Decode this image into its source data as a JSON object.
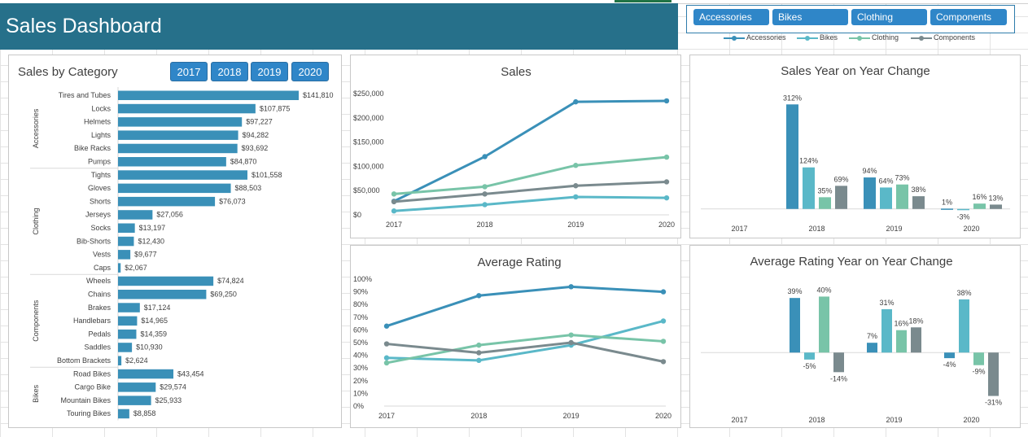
{
  "header": {
    "title": "Sales Dashboard"
  },
  "slicer": {
    "buttons": [
      "Accessories",
      "Bikes",
      "Clothing",
      "Components"
    ],
    "legend": [
      {
        "name": "Accessories",
        "color": "#3a90b8"
      },
      {
        "name": "Bikes",
        "color": "#5ab8c8"
      },
      {
        "name": "Clothing",
        "color": "#78c4a8"
      },
      {
        "name": "Components",
        "color": "#7a8a8e"
      }
    ]
  },
  "category_panel": {
    "title": "Sales by Category",
    "year_buttons": [
      "2017",
      "2018",
      "2019",
      "2020"
    ]
  },
  "chart_data": [
    {
      "id": "sales-by-category",
      "type": "bar",
      "orientation": "horizontal",
      "title": "Sales by Category",
      "color": "#3a90b8",
      "groups": [
        {
          "name": "Accessories",
          "items": [
            {
              "label": "Tires and Tubes",
              "value": 141810,
              "text": "$141,810"
            },
            {
              "label": "Locks",
              "value": 107875,
              "text": "$107,875"
            },
            {
              "label": "Helmets",
              "value": 97227,
              "text": "$97,227"
            },
            {
              "label": "Lights",
              "value": 94282,
              "text": "$94,282"
            },
            {
              "label": "Bike Racks",
              "value": 93692,
              "text": "$93,692"
            },
            {
              "label": "Pumps",
              "value": 84870,
              "text": "$84,870"
            }
          ]
        },
        {
          "name": "Clothing",
          "items": [
            {
              "label": "Tights",
              "value": 101558,
              "text": "$101,558"
            },
            {
              "label": "Gloves",
              "value": 88503,
              "text": "$88,503"
            },
            {
              "label": "Shorts",
              "value": 76073,
              "text": "$76,073"
            },
            {
              "label": "Jerseys",
              "value": 27056,
              "text": "$27,056"
            },
            {
              "label": "Socks",
              "value": 13197,
              "text": "$13,197"
            },
            {
              "label": "Bib-Shorts",
              "value": 12430,
              "text": "$12,430"
            },
            {
              "label": "Vests",
              "value": 9677,
              "text": "$9,677"
            },
            {
              "label": "Caps",
              "value": 2067,
              "text": "$2,067"
            }
          ]
        },
        {
          "name": "Components",
          "items": [
            {
              "label": "Wheels",
              "value": 74824,
              "text": "$74,824"
            },
            {
              "label": "Chains",
              "value": 69250,
              "text": "$69,250"
            },
            {
              "label": "Brakes",
              "value": 17124,
              "text": "$17,124"
            },
            {
              "label": "Handlebars",
              "value": 14965,
              "text": "$14,965"
            },
            {
              "label": "Pedals",
              "value": 14359,
              "text": "$14,359"
            },
            {
              "label": "Saddles",
              "value": 10930,
              "text": "$10,930"
            },
            {
              "label": "Bottom Brackets",
              "value": 2624,
              "text": "$2,624"
            }
          ]
        },
        {
          "name": "Bikes",
          "items": [
            {
              "label": "Road Bikes",
              "value": 43454,
              "text": "$43,454"
            },
            {
              "label": "Cargo Bike",
              "value": 29574,
              "text": "$29,574"
            },
            {
              "label": "Mountain Bikes",
              "value": 25933,
              "text": "$25,933"
            },
            {
              "label": "Touring Bikes",
              "value": 8858,
              "text": "$8,858"
            }
          ]
        }
      ]
    },
    {
      "id": "sales",
      "type": "line",
      "title": "Sales",
      "categories": [
        "2017",
        "2018",
        "2019",
        "2020"
      ],
      "ylim": [
        0,
        250000
      ],
      "yticks": [
        "$0",
        "$50,000",
        "$100,000",
        "$150,000",
        "$200,000",
        "$250,000"
      ],
      "series": [
        {
          "name": "Accessories",
          "color": "#3a90b8",
          "values": [
            28000,
            120000,
            233000,
            235000
          ]
        },
        {
          "name": "Bikes",
          "color": "#5ab8c8",
          "values": [
            8000,
            21000,
            37000,
            35000
          ]
        },
        {
          "name": "Clothing",
          "color": "#78c4a8",
          "values": [
            43000,
            58000,
            102000,
            119000
          ]
        },
        {
          "name": "Components",
          "color": "#7a8a8e",
          "values": [
            27000,
            43000,
            60000,
            68000
          ]
        }
      ]
    },
    {
      "id": "sales-yoy",
      "type": "bar",
      "title": "Sales Year on Year Change",
      "categories": [
        "2017",
        "2018",
        "2019",
        "2020"
      ],
      "ylim": [
        -20,
        320
      ],
      "series": [
        {
          "name": "Accessories",
          "color": "#3a90b8",
          "values": [
            null,
            312,
            94,
            1
          ],
          "labels": [
            "",
            "312%",
            "94%",
            "1%"
          ]
        },
        {
          "name": "Bikes",
          "color": "#5ab8c8",
          "values": [
            null,
            124,
            64,
            -3
          ],
          "labels": [
            "",
            "124%",
            "64%",
            "-3%"
          ]
        },
        {
          "name": "Clothing",
          "color": "#78c4a8",
          "values": [
            null,
            35,
            73,
            16
          ],
          "labels": [
            "",
            "35%",
            "73%",
            "16%"
          ]
        },
        {
          "name": "Components",
          "color": "#7a8a8e",
          "values": [
            null,
            69,
            38,
            13
          ],
          "labels": [
            "",
            "69%",
            "38%",
            "13%"
          ]
        }
      ]
    },
    {
      "id": "average-rating",
      "type": "line",
      "title": "Average Rating",
      "categories": [
        "2017",
        "2018",
        "2019",
        "2020"
      ],
      "ylim": [
        0,
        100
      ],
      "yticks": [
        "0%",
        "10%",
        "20%",
        "30%",
        "40%",
        "50%",
        "60%",
        "70%",
        "80%",
        "90%",
        "100%"
      ],
      "series": [
        {
          "name": "Accessories",
          "color": "#3a90b8",
          "values": [
            63,
            87,
            94,
            90
          ]
        },
        {
          "name": "Bikes",
          "color": "#5ab8c8",
          "values": [
            38,
            36,
            48,
            67
          ]
        },
        {
          "name": "Clothing",
          "color": "#78c4a8",
          "values": [
            34,
            48,
            56,
            51
          ]
        },
        {
          "name": "Components",
          "color": "#7a8a8e",
          "values": [
            49,
            42,
            50,
            35
          ]
        }
      ]
    },
    {
      "id": "rating-yoy",
      "type": "bar",
      "title": "Average Rating Year on Year Change",
      "categories": [
        "2017",
        "2018",
        "2019",
        "2020"
      ],
      "ylim": [
        -33,
        42
      ],
      "series": [
        {
          "name": "Accessories",
          "color": "#3a90b8",
          "values": [
            null,
            39,
            7,
            -4
          ],
          "labels": [
            "",
            "39%",
            "7%",
            "-4%"
          ]
        },
        {
          "name": "Bikes",
          "color": "#5ab8c8",
          "values": [
            null,
            -5,
            31,
            38
          ],
          "labels": [
            "",
            "-5%",
            "31%",
            "38%"
          ]
        },
        {
          "name": "Clothing",
          "color": "#78c4a8",
          "values": [
            null,
            40,
            16,
            -9
          ],
          "labels": [
            "",
            "40%",
            "16%",
            "-9%"
          ]
        },
        {
          "name": "Components",
          "color": "#7a8a8e",
          "values": [
            null,
            -14,
            18,
            -31
          ],
          "labels": [
            "",
            "-14%",
            "18%",
            "-31%"
          ]
        }
      ]
    }
  ]
}
